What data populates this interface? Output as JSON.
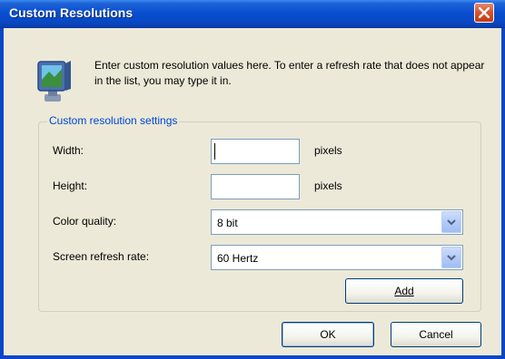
{
  "window": {
    "title": "Custom Resolutions",
    "close_icon": "close-icon"
  },
  "intro": {
    "icon": "display-monitor-icon",
    "text": "Enter custom resolution values here. To enter a refresh rate that does not appear in the list, you may type it in."
  },
  "group": {
    "legend": "Custom resolution settings",
    "width": {
      "label": "Width:",
      "value": "",
      "unit": "pixels"
    },
    "height": {
      "label": "Height:",
      "value": "",
      "unit": "pixels"
    },
    "color_quality": {
      "label": "Color quality:",
      "selected": "8 bit"
    },
    "refresh_rate": {
      "label": "Screen refresh rate:",
      "selected": "60 Hertz"
    },
    "add_button": "Add"
  },
  "buttons": {
    "ok": "OK",
    "cancel": "Cancel"
  },
  "colors": {
    "title_bar": "#0a4fd0",
    "dialog_background": "#ece9d8",
    "group_legend": "#0046d5",
    "close_button": "#d5522d"
  }
}
